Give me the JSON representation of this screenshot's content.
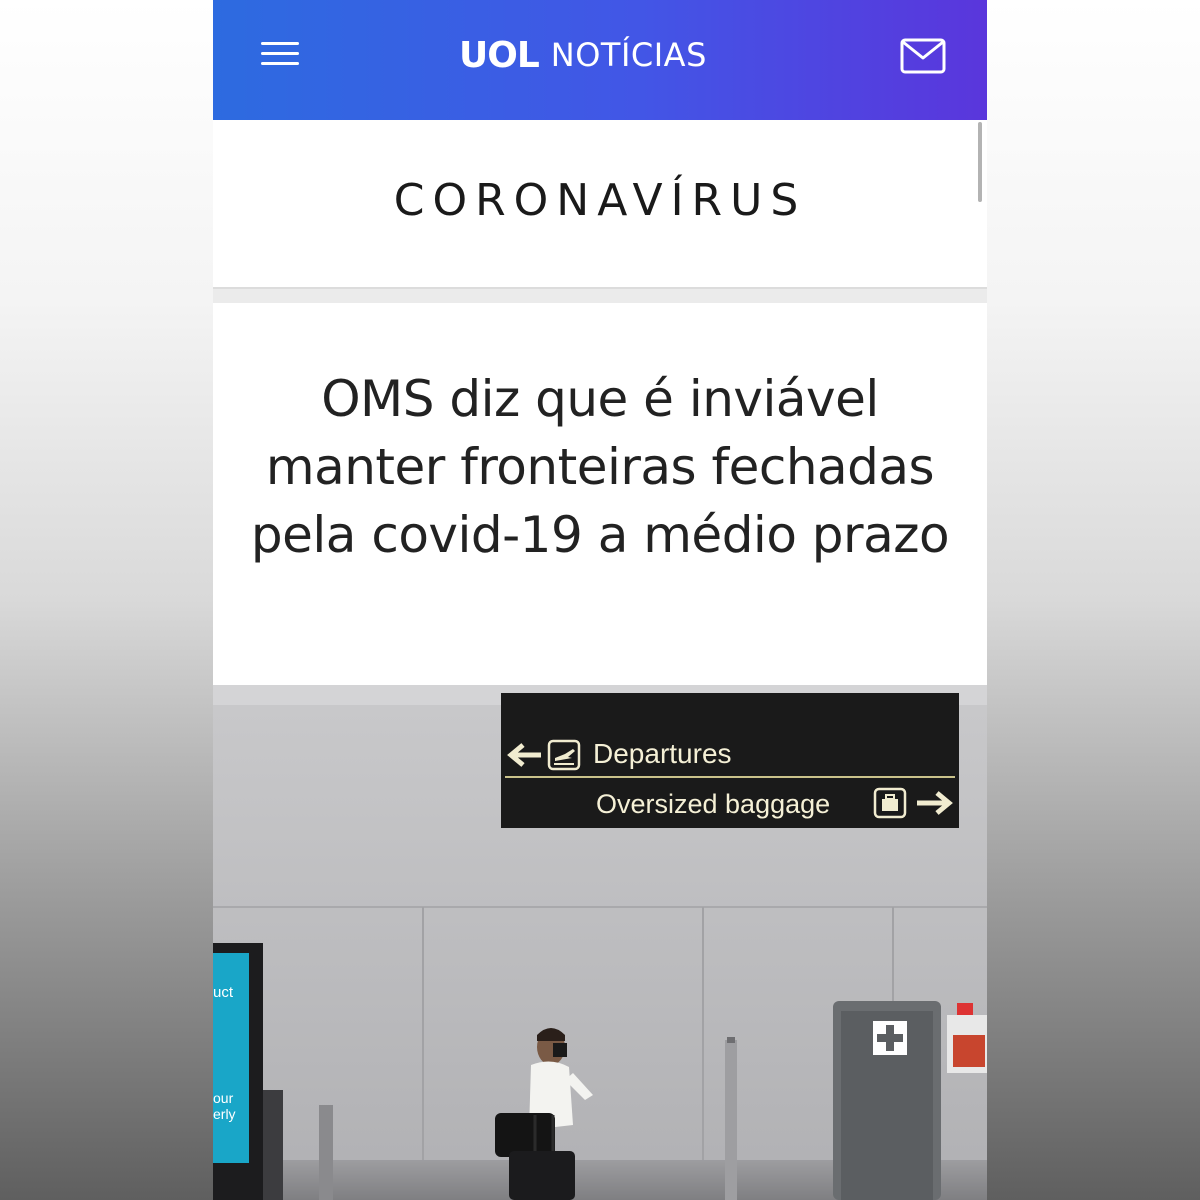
{
  "header": {
    "brand_logo": "UOL",
    "brand_section": "NOTÍCIAS",
    "menu_icon": "hamburger-menu-icon",
    "mail_icon": "envelope-icon",
    "gradient_colors": [
      "#2d6be0",
      "#5a36dc"
    ]
  },
  "section": {
    "title": "CORONAVÍRUS"
  },
  "article": {
    "headline": "OMS diz que é inviável manter fronteiras fechadas pela covid-19 a médio prazo"
  },
  "photo": {
    "sign_departures": "Departures",
    "sign_oversized": "Oversized baggage",
    "kiosk_fragment_1": "uct",
    "kiosk_fragment_2": "our",
    "kiosk_fragment_3": "erly"
  }
}
